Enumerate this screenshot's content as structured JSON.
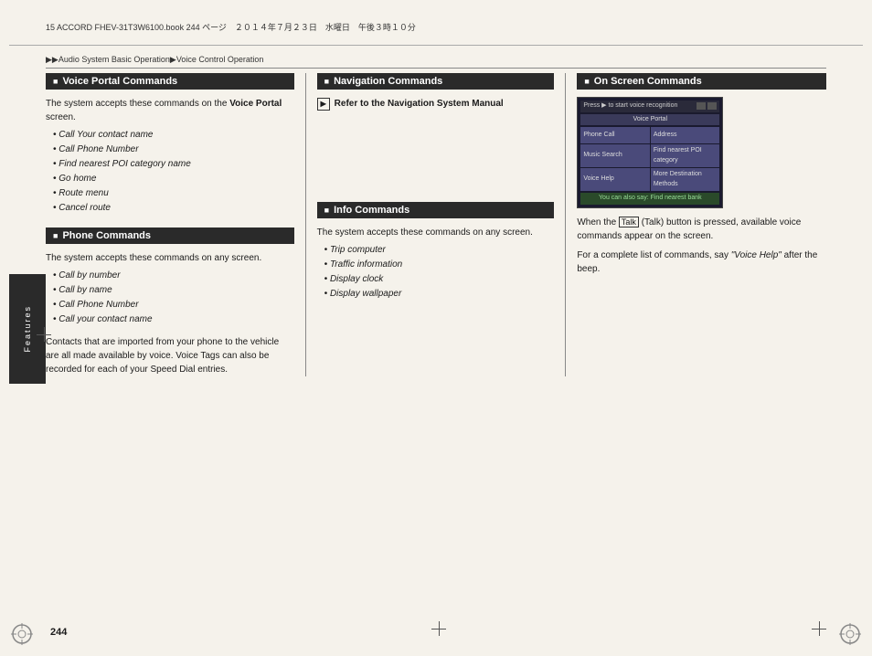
{
  "page": {
    "number": "244",
    "header_text": "15 ACCORD FHEV-31T3W6100.book  244 ページ　２０１４年７月２３日　水曜日　午後３時１０分"
  },
  "breadcrumb": {
    "text": "▶▶Audio System Basic Operation▶Voice Control Operation"
  },
  "features_label": "Features",
  "sections": {
    "voice_portal": {
      "title": "Voice Portal Commands",
      "intro": "The system accepts these commands on the",
      "bold_word": "Voice Portal",
      "intro_end": " screen.",
      "items": [
        "Call Your contact name",
        "Call Phone Number",
        "Find nearest POI category name",
        "Go home",
        "Route menu",
        "Cancel route"
      ]
    },
    "navigation": {
      "title": "Navigation Commands",
      "note": "Refer to the Navigation System Manual",
      "screen_title": "Voice Portal",
      "screen_top": "Press ▶ to start voice recognition",
      "screen_cells": [
        "Phone Call",
        "Address",
        "Music Search",
        "Find nearest POI category",
        "Voice Help",
        "More Destination Methods"
      ],
      "screen_bottom": "You can also say: Find nearest bank"
    },
    "on_screen": {
      "title": "On Screen Commands",
      "para1": "When the",
      "talk_icon": "Talk",
      "para1_mid": "(Talk) button is pressed, available voice commands appear on the screen.",
      "para2": "For a complete list of commands, say",
      "voice_help": "\"Voice Help\"",
      "para2_end": " after the beep."
    },
    "phone": {
      "title": "Phone Commands",
      "intro": "The system accepts these commands on any screen.",
      "items": [
        "Call by number",
        "Call by name",
        "Call Phone Number",
        "Call your contact name"
      ],
      "extra": "Contacts that are imported from your phone to the vehicle are all made available by voice. Voice Tags can also be recorded for each of your Speed Dial entries."
    },
    "info": {
      "title": "Info Commands",
      "intro": "The system accepts these commands on any screen.",
      "items": [
        "Trip computer",
        "Traffic information",
        "Display clock",
        "Display wallpaper"
      ]
    }
  }
}
